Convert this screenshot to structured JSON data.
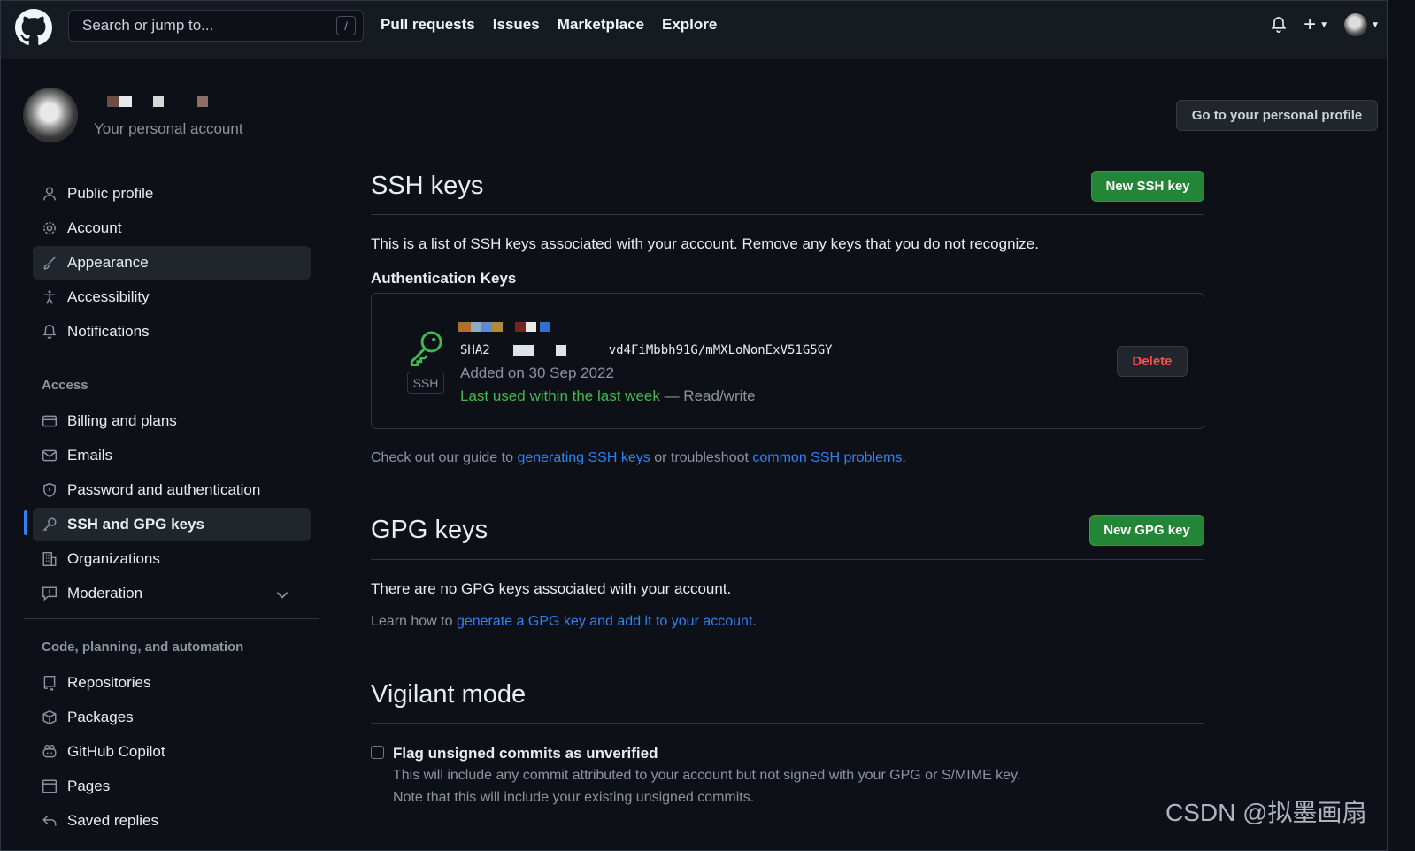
{
  "header": {
    "search_placeholder": "Search or jump to...",
    "search_shortcut": "/",
    "nav": [
      "Pull requests",
      "Issues",
      "Marketplace",
      "Explore"
    ]
  },
  "profile": {
    "subtitle": "Your personal account",
    "go_profile_label": "Go to your personal profile"
  },
  "sidebar": {
    "items_top": [
      {
        "label": "Public profile",
        "icon": "person-icon"
      },
      {
        "label": "Account",
        "icon": "gear-icon"
      },
      {
        "label": "Appearance",
        "icon": "paintbrush-icon"
      },
      {
        "label": "Accessibility",
        "icon": "accessibility-icon"
      },
      {
        "label": "Notifications",
        "icon": "bell-icon"
      }
    ],
    "access_heading": "Access",
    "items_access": [
      {
        "label": "Billing and plans",
        "icon": "credit-card-icon"
      },
      {
        "label": "Emails",
        "icon": "mail-icon"
      },
      {
        "label": "Password and authentication",
        "icon": "shield-lock-icon"
      },
      {
        "label": "SSH and GPG keys",
        "icon": "key-icon"
      },
      {
        "label": "Organizations",
        "icon": "organization-icon"
      },
      {
        "label": "Moderation",
        "icon": "report-icon"
      }
    ],
    "code_heading": "Code, planning, and automation",
    "items_code": [
      {
        "label": "Repositories",
        "icon": "repo-icon"
      },
      {
        "label": "Packages",
        "icon": "package-icon"
      },
      {
        "label": "GitHub Copilot",
        "icon": "copilot-icon"
      },
      {
        "label": "Pages",
        "icon": "browser-icon"
      },
      {
        "label": "Saved replies",
        "icon": "reply-icon"
      }
    ]
  },
  "ssh": {
    "title": "SSH keys",
    "new_button": "New SSH key",
    "description": "This is a list of SSH keys associated with your account. Remove any keys that you do not recognize.",
    "auth_heading": "Authentication Keys",
    "key": {
      "badge": "SSH",
      "fingerprint_prefix": "SHA2",
      "fingerprint_suffix": "vd4FiMbbh91G/mMXLoNonExV51G5GY",
      "added": "Added on 30 Sep 2022",
      "last_used": "Last used within the last week",
      "access": " — Read/write",
      "delete_label": "Delete"
    },
    "guide_prefix": "Check out our guide to ",
    "guide_link1": "generating SSH keys",
    "guide_middle": " or troubleshoot ",
    "guide_link2": "common SSH problems",
    "guide_suffix": "."
  },
  "gpg": {
    "title": "GPG keys",
    "new_button": "New GPG key",
    "empty_text": "There are no GPG keys associated with your account.",
    "learn_prefix": "Learn how to ",
    "learn_link": "generate a GPG key and add it to your account",
    "learn_suffix": "."
  },
  "vigilant": {
    "title": "Vigilant mode",
    "checkbox_label": "Flag unsigned commits as unverified",
    "desc1": "This will include any commit attributed to your account but not signed with your GPG or S/MIME key.",
    "desc2": "Note that this will include your existing unsigned commits."
  },
  "watermark": {
    "text": "CSDN @拟墨画扇"
  },
  "colors": {
    "accent": "#2f81f7",
    "green_button": "#238636",
    "danger": "#f85149",
    "success_text": "#3fb950",
    "bg": "#0d1117"
  }
}
